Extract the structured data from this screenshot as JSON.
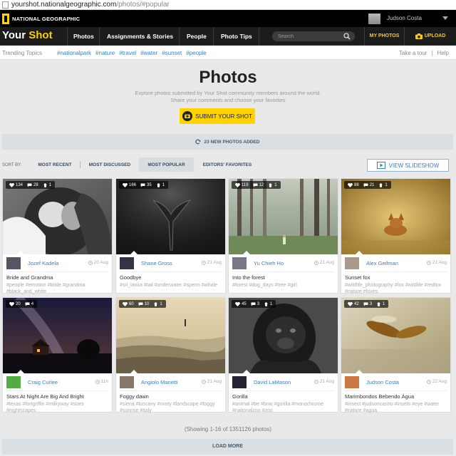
{
  "browser": {
    "domain": "yourshot.nationalgeographic.com",
    "path": "/photos/#popular"
  },
  "topbar": {
    "logo_text": "NATIONAL GEOGRAPHIC",
    "username": "Judson Costa"
  },
  "nav": {
    "brand_your": "Your",
    "brand_shot": "Shot",
    "items": [
      "Photos",
      "Assignments & Stories",
      "People",
      "Photo Tips"
    ],
    "search_placeholder": "Search",
    "my_photos": "MY PHOTOS",
    "upload": "UPLOAD"
  },
  "trending": {
    "label": "Trending Topics",
    "tags": [
      "#nationalpark",
      "#nature",
      "#travel",
      "#water",
      "#sunset",
      "#people"
    ],
    "take_tour": "Take a tour",
    "separator": "|",
    "help": "Help"
  },
  "header": {
    "title": "Photos",
    "subtitle_1": "Explore photos submitted by Your Shot community members around the world.",
    "subtitle_2": "Share your comments and choose your favorites",
    "submit": "SUBMIT YOUR SHOT"
  },
  "new_photos": "23 NEW PHOTOS ADDED",
  "sort": {
    "label": "SORT BY:",
    "options": [
      "MOST RECENT",
      "MOST DISCUSSED",
      "MOST POPULAR",
      "EDITORS' FAVORITES"
    ],
    "active": "MOST POPULAR",
    "slideshow": "VIEW SLIDESHOW"
  },
  "photos": [
    {
      "likes": "134",
      "comments": "28",
      "favs": "1",
      "user": "Jozef Kadela",
      "date": "20 Aug",
      "title": "Bride and Grandma",
      "tags": "#people #emotion #bride #grandma #black_and_white",
      "palette": "bw-bride"
    },
    {
      "likes": "166",
      "comments": "35",
      "favs": "1",
      "user": "Shane Gross",
      "date": "21 Aug",
      "title": "Goodbye",
      "tags": "#sri_lanka #tail #underwater #sperm #whale",
      "palette": "bw-whale"
    },
    {
      "likes": "119",
      "comments": "12",
      "favs": "1",
      "user": "Yu Chieh Ho",
      "date": "21 Aug",
      "title": "Into the forest",
      "tags": "#forest #dog_days #tree #girl",
      "palette": "forest"
    },
    {
      "likes": "88",
      "comments": "21",
      "favs": "1",
      "user": "Alex Geifman",
      "date": "21 Aug",
      "title": "Sunset fox",
      "tags": "#wildlife_photography #fox #wildlife #redfox #nature #foxes",
      "palette": "fox"
    },
    {
      "likes": "20",
      "comments": "4",
      "favs": "",
      "user": "Craig Curlee",
      "date": "11h",
      "title": "Stars At Night Are Big And Bright",
      "tags": "#texas #fortgriffin #milkyway #stars #nightscapes",
      "palette": "night"
    },
    {
      "likes": "60",
      "comments": "10",
      "favs": "1",
      "user": "Angiolo Manetti",
      "date": "21 Aug",
      "title": "Foggy dawn",
      "tags": "#siena #tuscany #misty #landscape #foggy #sunrise #italy",
      "palette": "fog"
    },
    {
      "likes": "45",
      "comments": "3",
      "favs": "1",
      "user": "David LaMason",
      "date": "21 Aug",
      "title": "Gorilla",
      "tags": "#animal #be #bnw #gorilla #monochrome #nationalzoo #zoo",
      "palette": "gorilla"
    },
    {
      "likes": "42",
      "comments": "3",
      "favs": "1",
      "user": "Judson Costa",
      "date": "22 Aug",
      "title": "Marimbondos Bebendo Água",
      "tags": "#insect #judsoncastro #inseto #eye #water #nature #agua",
      "palette": "wasp"
    }
  ],
  "showing": "(Showing 1-16 of 1351126 photos)",
  "load_more": "LOAD MORE",
  "colors": {
    "accent_yellow": "#ffd200",
    "link_blue": "#3a7fc2",
    "nav_bg": "#1c1c1c"
  }
}
